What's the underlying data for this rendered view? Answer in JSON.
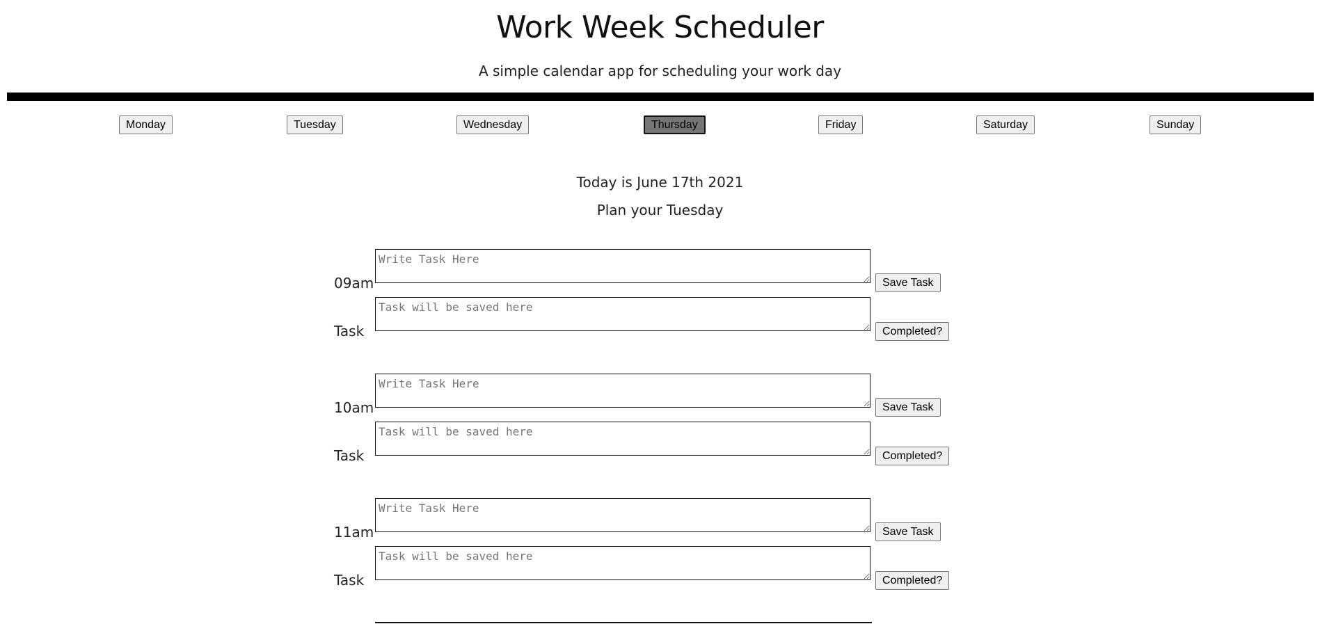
{
  "header": {
    "title": "Work Week Scheduler",
    "subtitle": "A simple calendar app for scheduling your work day"
  },
  "days": {
    "selected": "Thursday",
    "items": [
      {
        "label": "Monday"
      },
      {
        "label": "Tuesday"
      },
      {
        "label": "Wednesday"
      },
      {
        "label": "Thursday"
      },
      {
        "label": "Friday"
      },
      {
        "label": "Saturday"
      },
      {
        "label": "Sunday"
      }
    ]
  },
  "status": {
    "today": "Today is June 17th 2021",
    "plan": "Plan your Tuesday"
  },
  "hours": [
    {
      "hour_label": "09am",
      "task_label": "Task",
      "task_input_placeholder": "Write Task Here",
      "saved_task_placeholder": "Task will be saved here",
      "save_button": "Save Task",
      "completed_button": "Completed?"
    },
    {
      "hour_label": "10am",
      "task_label": "Task",
      "task_input_placeholder": "Write Task Here",
      "saved_task_placeholder": "Task will be saved here",
      "save_button": "Save Task",
      "completed_button": "Completed?"
    },
    {
      "hour_label": "11am",
      "task_label": "Task",
      "task_input_placeholder": "Write Task Here",
      "saved_task_placeholder": "Task will be saved here",
      "save_button": "Save Task",
      "completed_button": "Completed?"
    }
  ]
}
